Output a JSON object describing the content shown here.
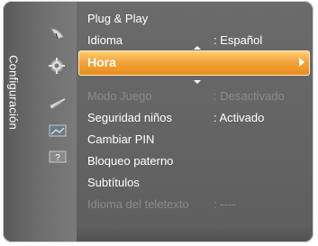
{
  "sidebar": {
    "title": "Configuración",
    "icons": [
      "satellite-dish-icon",
      "gear-icon",
      "antenna-icon",
      "picture-input-icon",
      "help-icon"
    ]
  },
  "menu": {
    "items": [
      {
        "label": "Plug & Play",
        "value": ""
      },
      {
        "label": "Idioma",
        "value": ": Español"
      },
      {
        "label": "Hora",
        "value": ""
      },
      {
        "label": "Modo Juego",
        "value": ": Desactivado"
      },
      {
        "label": "Seguridad niños",
        "value": ": Activado"
      },
      {
        "label": "Cambiar PIN",
        "value": ""
      },
      {
        "label": "Bloqueo paterno",
        "value": ""
      },
      {
        "label": "Subtítulos",
        "value": ""
      },
      {
        "label": "Idioma del teletexto",
        "value": ": ----"
      }
    ]
  },
  "colors": {
    "highlight": "#f4a43a",
    "text": "#ffffff",
    "disabled": "#8c8c8c"
  }
}
